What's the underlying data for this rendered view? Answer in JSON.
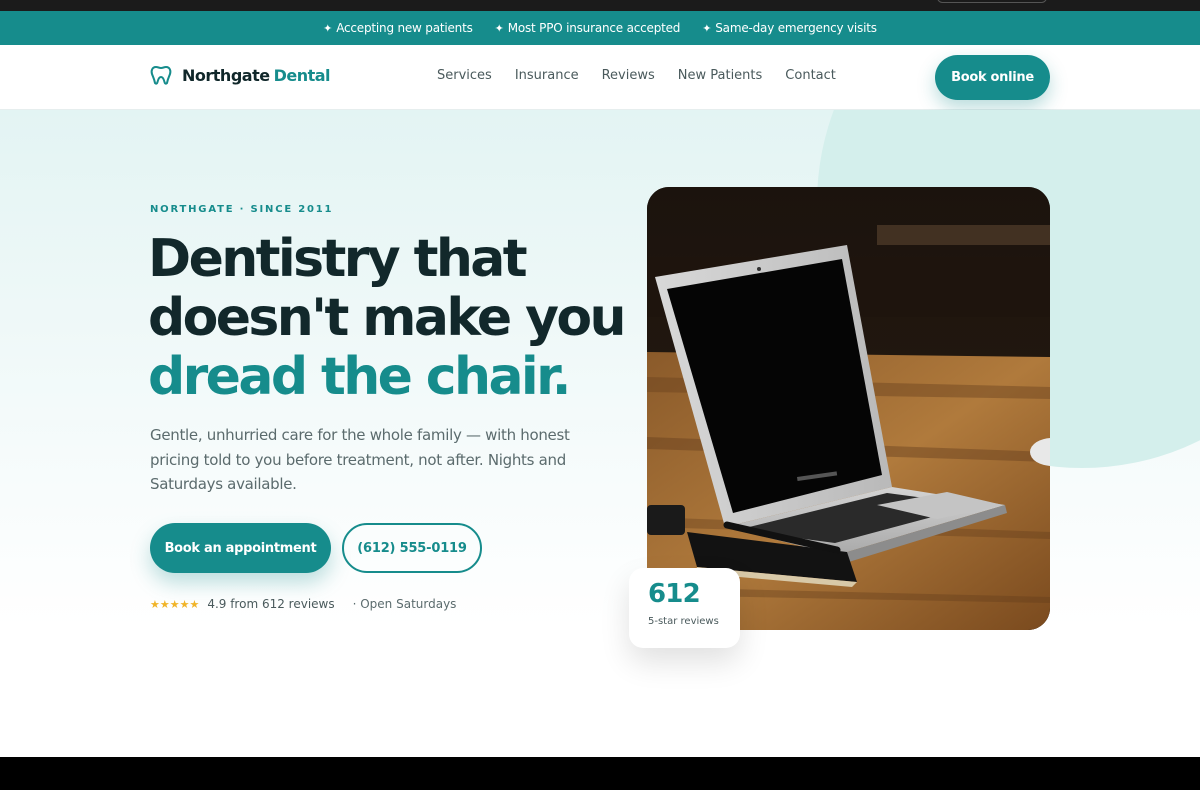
{
  "announcement": {
    "items": [
      {
        "icon": "sparkle-icon",
        "text": "Accepting new patients"
      },
      {
        "icon": "sparkle-icon",
        "text": "Most PPO insurance accepted"
      },
      {
        "icon": "sparkle-icon",
        "text": "Same-day emergency visits"
      }
    ]
  },
  "nav": {
    "brand_name": "Northgate",
    "brand_accent": "Dental",
    "brand_icon": "tooth-icon",
    "links": [
      "Services",
      "Insurance",
      "Reviews",
      "New Patients",
      "Contact"
    ],
    "cta": "Book online"
  },
  "hero": {
    "eyebrow": "NORTHGATE · SINCE 2011",
    "headline_line1": "Dentistry that",
    "headline_line2": "doesn't make you",
    "headline_accent": "dread the chair.",
    "subtext": "Gentle, unhurried care for the whole family — with honest pricing told to you before treatment, not after. Nights and Saturdays available.",
    "primary_cta": "Book an appointment",
    "phone_cta": "(612) 555-0119",
    "stars": "★★★★★",
    "rating_text": "4.9 from 612 reviews",
    "open_text": "· Open Saturdays",
    "stat_number": "612",
    "stat_label": "5-star reviews"
  },
  "colors": {
    "accent": "#168c8c",
    "dark": "#12282b",
    "star": "#f0b429"
  }
}
